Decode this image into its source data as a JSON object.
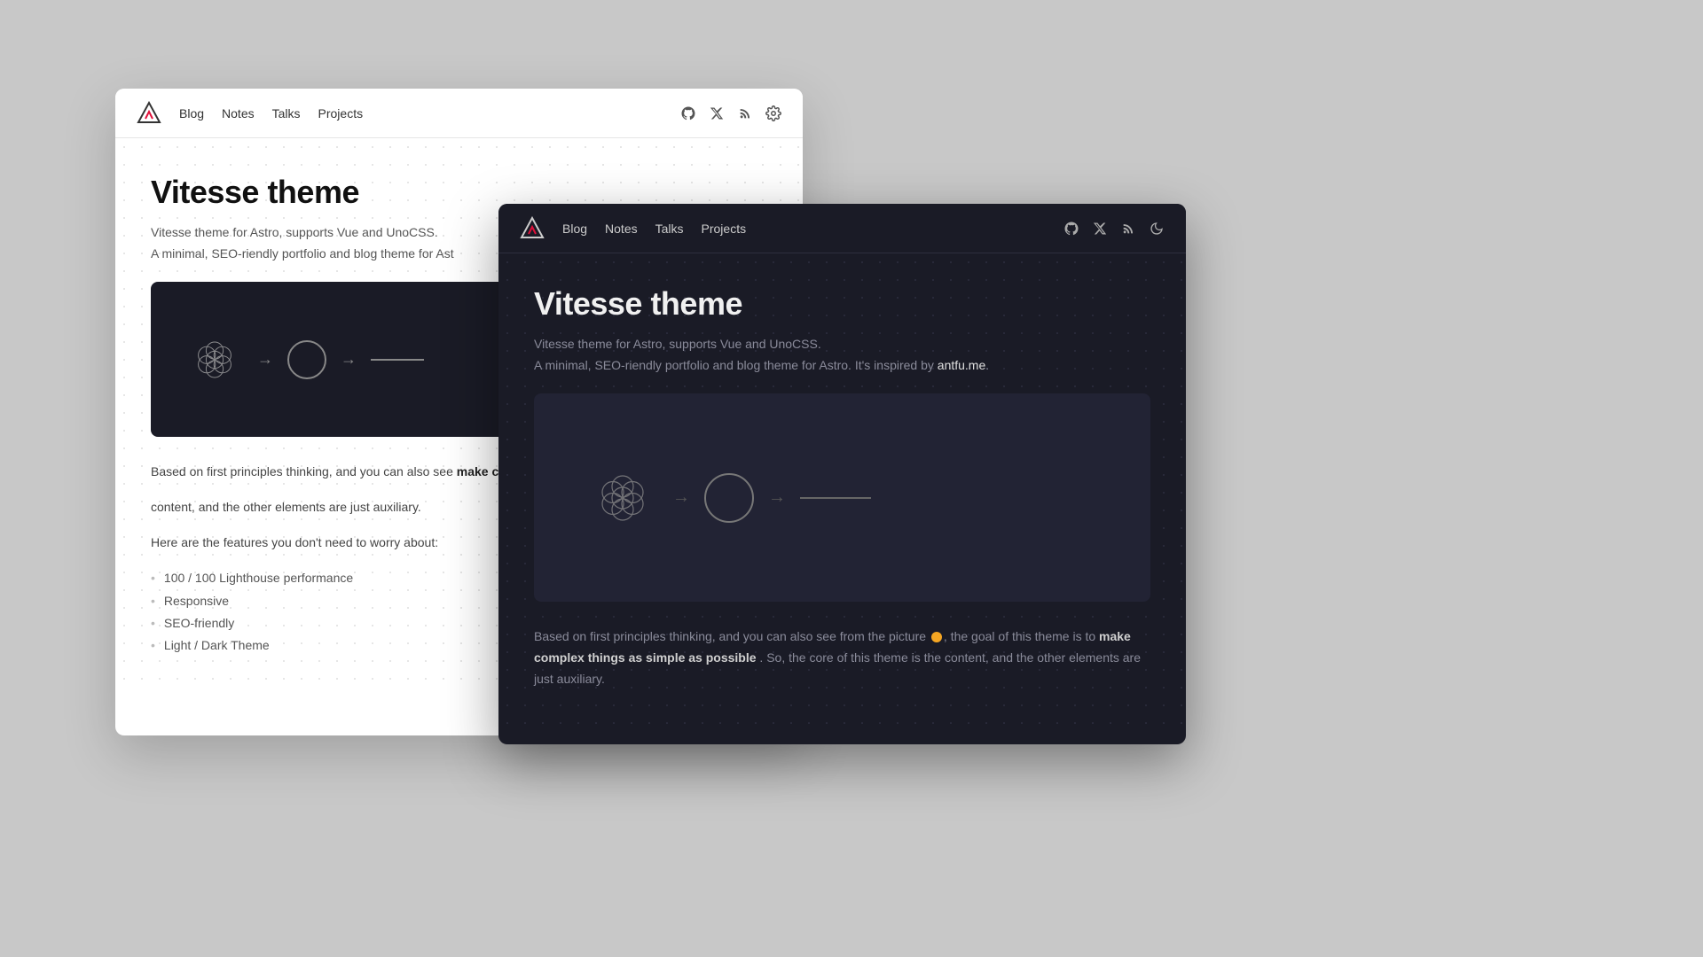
{
  "background": "#c8c8c8",
  "lightWindow": {
    "nav": {
      "links": [
        "Blog",
        "Notes",
        "Talks",
        "Projects"
      ],
      "icons": [
        "github",
        "x-twitter",
        "rss",
        "settings"
      ]
    },
    "content": {
      "title": "Vitesse theme",
      "subtitle": "Vitesse theme for Astro, supports Vue and UnoCSS.",
      "description": "A minimal, SEO-riendly portfolio and blog theme for Ast",
      "bodyText1": "Based on first principles thinking, and you can also see",
      "bodyTextBold": "make complex things as simple as possib",
      "bodyText2": "content, and the other elements are just auxiliary.",
      "featuresLabel": "Here are the features you don't need to worry about:",
      "features": [
        "100 / 100 Lighthouse performance",
        "Responsive",
        "SEO-friendly",
        "Light / Dark Theme"
      ]
    }
  },
  "darkWindow": {
    "nav": {
      "links": [
        "Blog",
        "Notes",
        "Talks",
        "Projects"
      ],
      "icons": [
        "github",
        "x-twitter",
        "rss",
        "moon"
      ]
    },
    "content": {
      "title": "Vitesse theme",
      "subtitle": "Vitesse theme for Astro, supports Vue and UnoCSS.",
      "description": "A minimal, SEO-riendly portfolio and blog theme for Astro. It's inspired by",
      "descriptionLink": "antfu.me",
      "bodyText1": "Based on first principles thinking, and you can also see from the picture",
      "bodyTextBold": "make complex things as simple as possible",
      "bodyText2": ". So, the core of this theme is the content, and the other elements are just auxiliary."
    }
  }
}
